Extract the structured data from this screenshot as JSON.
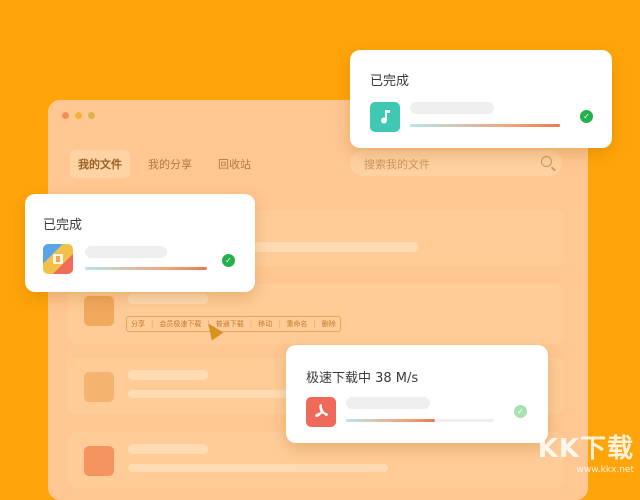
{
  "window": {
    "tabs": [
      {
        "label": "我的文件",
        "active": true
      },
      {
        "label": "我的分享",
        "active": false
      },
      {
        "label": "回收站",
        "active": false
      }
    ],
    "search_placeholder": "搜索我的文件",
    "actions": [
      "分享",
      "会员极速下载",
      "普通下载",
      "移动",
      "重命名",
      "删除"
    ]
  },
  "cards": {
    "top_right": {
      "status": "已完成",
      "icon": "music-file-icon",
      "progress": 1.0
    },
    "left": {
      "status": "已完成",
      "icon": "archive-file-icon",
      "progress": 1.0
    },
    "bottom": {
      "status": "极速下载中 38 M/s",
      "icon": "pdf-file-icon",
      "progress": 0.6
    }
  },
  "watermark": {
    "brand": "KK下载",
    "url": "www.kkx.net"
  },
  "colors": {
    "background": "#ffa50a",
    "success": "#24b04a",
    "accent": "#e37b55"
  }
}
